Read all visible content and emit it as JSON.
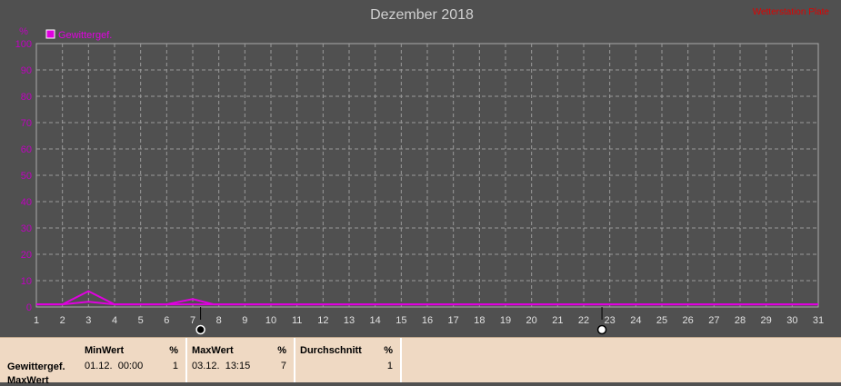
{
  "chart_data": {
    "type": "line",
    "title": "Dezember 2018",
    "watermark": "Wetterstation Plate",
    "ylabel": "%",
    "ylim": [
      0,
      100
    ],
    "yticks": [
      0,
      10,
      20,
      30,
      40,
      50,
      60,
      70,
      80,
      90,
      100
    ],
    "xlim": [
      1,
      31
    ],
    "xticks": [
      1,
      2,
      3,
      4,
      5,
      6,
      7,
      8,
      9,
      10,
      11,
      12,
      13,
      14,
      15,
      16,
      17,
      18,
      19,
      20,
      21,
      22,
      23,
      24,
      25,
      26,
      27,
      28,
      29,
      30,
      31
    ],
    "grid": true,
    "legend_position": "top-left",
    "moon_markers": [
      {
        "day": 7.3,
        "phase": "new-moon"
      },
      {
        "day": 22.7,
        "phase": "full-moon"
      }
    ],
    "series": [
      {
        "name": "Gewittergef.",
        "color": "#e000e0",
        "x": [
          1,
          2,
          3,
          4,
          5,
          6,
          7,
          7.8,
          9,
          31
        ],
        "y": [
          1,
          1,
          6,
          1,
          1,
          1,
          3,
          1,
          1,
          1
        ]
      },
      {
        "name": "",
        "color": "#e000e0",
        "x": [
          1,
          2,
          3,
          4,
          31
        ],
        "y": [
          1,
          1,
          2,
          1,
          1
        ]
      }
    ],
    "colors": {
      "background": "#505050",
      "grid": "#9a9a9a",
      "axis_text": "#c000c0",
      "title": "#d0d0d0",
      "x_ticks": "#e0e0e0",
      "watermark": "#e00000"
    }
  },
  "stats": {
    "row_label": "Gewittergef.",
    "row_label_cut": "MaxWert",
    "columns": [
      {
        "header": "MinWert",
        "unit": "%",
        "value_text": "01.12.  00:00",
        "value": "1"
      },
      {
        "header": "MaxWert",
        "unit": "%",
        "value_text": "03.12.  13:15",
        "value": "7"
      },
      {
        "header": "Durchschnitt",
        "unit": "%",
        "value_text": "",
        "value": "1"
      }
    ]
  }
}
